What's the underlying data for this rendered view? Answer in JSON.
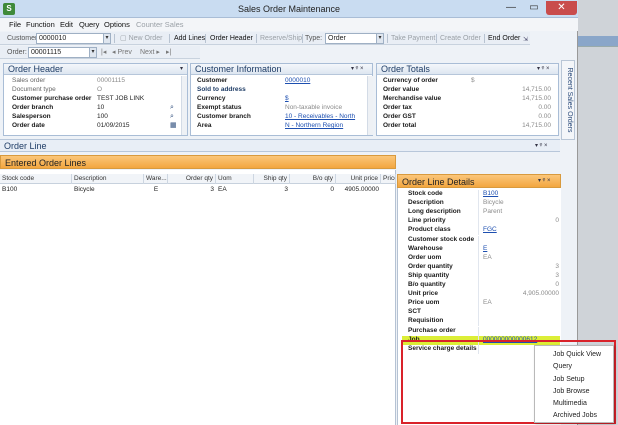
{
  "window": {
    "title": "Sales Order Maintenance",
    "close_glyph": "✕",
    "min_glyph": "—",
    "max_glyph": "▭"
  },
  "menu": [
    "File",
    "Function",
    "Edit",
    "Query",
    "Options",
    "Counter Sales"
  ],
  "toolbar1": {
    "customer_label": "Customer:",
    "customer_value": "0000010",
    "new_order": "New Order",
    "add_lines": "Add Lines",
    "order_header": "Order Header",
    "reserve_ship": "Reserve/Ship",
    "type_label": "Type:",
    "type_value": "Order",
    "take_payment": "Take Payment",
    "create_order": "Create Order",
    "end_order": "End Order"
  },
  "toolbar2": {
    "order_label": "Order:",
    "order_value": "00001115",
    "prev": "Prev",
    "next": "Next"
  },
  "side_tab": "Recent Sales Orders",
  "order_header": {
    "title": "Order Header",
    "rows": [
      {
        "label": "Sales order",
        "value": "00001115",
        "dim": true
      },
      {
        "label": "Document type",
        "value": "O",
        "dim": true
      },
      {
        "label": "Customer purchase order",
        "value": "TEST JOB LINK"
      },
      {
        "label": "Order branch",
        "value": "10"
      },
      {
        "label": "Salesperson",
        "value": "100"
      },
      {
        "label": "Order date",
        "value": "01/09/2015"
      }
    ]
  },
  "customer_information": {
    "title": "Customer Information",
    "rows": [
      {
        "label": "Customer",
        "value": "0000010",
        "link": true
      },
      {
        "label": "Sold to address",
        "value": ""
      },
      {
        "label": "Currency",
        "value": "$",
        "link": true
      },
      {
        "label": "Exempt status",
        "value": "Non-taxable invoice",
        "dim": true
      },
      {
        "label": "Customer branch",
        "value": "10 - Receivables - North",
        "link": true
      },
      {
        "label": "Area",
        "value": "N - Northern Region",
        "link": true
      }
    ]
  },
  "order_totals": {
    "title": "Order Totals",
    "rows": [
      {
        "label": "Currency of order",
        "value": "$"
      },
      {
        "label": "Order value",
        "value": "14,715.00"
      },
      {
        "label": "Merchandise value",
        "value": "14,715.00"
      },
      {
        "label": "Order tax",
        "value": "0.00"
      },
      {
        "label": "Order GST",
        "value": "0.00"
      },
      {
        "label": "Order total",
        "value": "14,715.00"
      }
    ]
  },
  "order_line": {
    "title": "Order Line"
  },
  "entered_lines": {
    "title": "Entered Order Lines",
    "columns": [
      "Stock code",
      "Description",
      "Ware...",
      "Order qty",
      "Uom",
      "Ship qty",
      "B/o qty",
      "Unit price",
      "Price"
    ],
    "rows": [
      [
        "B100",
        "Bicycle",
        "E",
        "3",
        "EA",
        "3",
        "0",
        "4905.00000",
        ""
      ]
    ]
  },
  "line_details": {
    "title": "Order Line Details",
    "rows": [
      {
        "label": "Stock code",
        "value": "B100",
        "link": true
      },
      {
        "label": "Description",
        "value": "Bicycle",
        "dim": true
      },
      {
        "label": "Long description",
        "value": "Parent",
        "dim": true
      },
      {
        "label": "Line priority",
        "value": "0",
        "right": true
      },
      {
        "label": "Product class",
        "value": "FGC",
        "link": true
      },
      {
        "label": "Customer stock code",
        "value": ""
      },
      {
        "label": "Warehouse",
        "value": "E",
        "link": true
      },
      {
        "label": "Order uom",
        "value": "EA",
        "dim": true
      },
      {
        "label": "Order quantity",
        "value": "3",
        "right": true
      },
      {
        "label": "Ship quantity",
        "value": "3",
        "right": true
      },
      {
        "label": "B/o quantity",
        "value": "0",
        "right": true
      },
      {
        "label": "Unit price",
        "value": "4,905.00000",
        "right": true
      },
      {
        "label": "Price uom",
        "value": "EA",
        "dim": true
      },
      {
        "label": "SCT",
        "value": ""
      },
      {
        "label": "Requisition",
        "value": ""
      },
      {
        "label": "Purchase order",
        "value": ""
      },
      {
        "label": "Job",
        "value": "000000000000612",
        "link": true
      },
      {
        "label": "Service charge details",
        "value": ""
      }
    ]
  },
  "context_menu": [
    "Job Quick View",
    "Query",
    "Job Setup",
    "Job Browse",
    "Multimedia",
    "Archived Jobs"
  ],
  "colors": {
    "accent_orange": "#f3a640",
    "highlight_yellow": "#dcee37",
    "frame_red": "#d9222a",
    "link_blue": "#1d4fb0"
  }
}
